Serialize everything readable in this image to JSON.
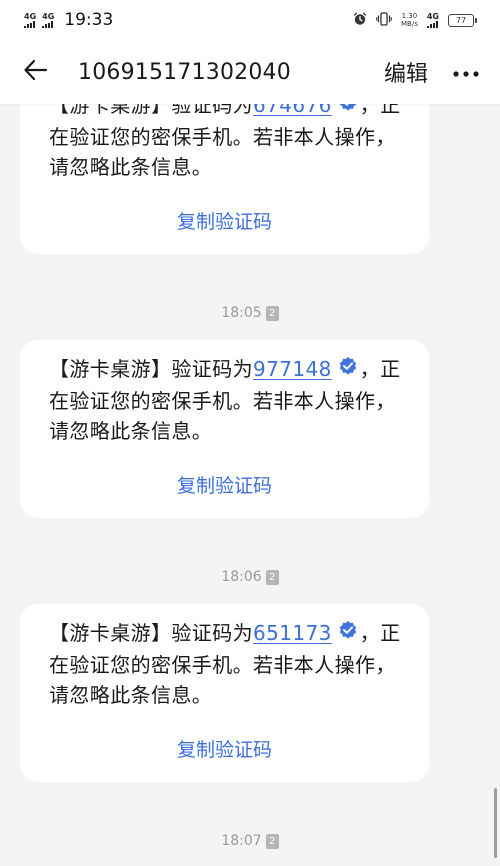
{
  "status_bar": {
    "signal_1": "4G",
    "signal_2": "4G",
    "time": "19:33",
    "net_speed_value": "1.30",
    "net_speed_unit": "MB/s",
    "network_type": "4G",
    "battery_level": "77",
    "icons": [
      "alarm-icon",
      "vibrate-icon",
      "hd-signal-icon",
      "battery-icon"
    ]
  },
  "header": {
    "sender": "106915171302040",
    "edit_label": "编辑",
    "icons": [
      "back-arrow-icon",
      "more-icon"
    ]
  },
  "messages": [
    {
      "prefix": "【游卡桌游】验证码为",
      "code": "674676",
      "suffix": "，正在验证您的密保手机。若非本人操作，请忽略此条信息。",
      "copy_label": "复制验证码"
    },
    {
      "timestamp": "18:05",
      "sim": "2",
      "prefix": "【游卡桌游】验证码为",
      "code": "977148",
      "suffix": "，正在验证您的密保手机。若非本人操作，请忽略此条信息。",
      "copy_label": "复制验证码"
    },
    {
      "timestamp": "18:06",
      "sim": "2",
      "prefix": "【游卡桌游】验证码为",
      "code": "651173",
      "suffix": "，正在验证您的密保手机。若非本人操作，请忽略此条信息。",
      "copy_label": "复制验证码"
    }
  ],
  "last_timestamp": {
    "time": "18:07",
    "sim": "2"
  },
  "colors": {
    "link_blue": "#3d6fd8",
    "background": "#f4f4f4",
    "bubble": "#ffffff",
    "verified_badge": "#3f73de"
  }
}
